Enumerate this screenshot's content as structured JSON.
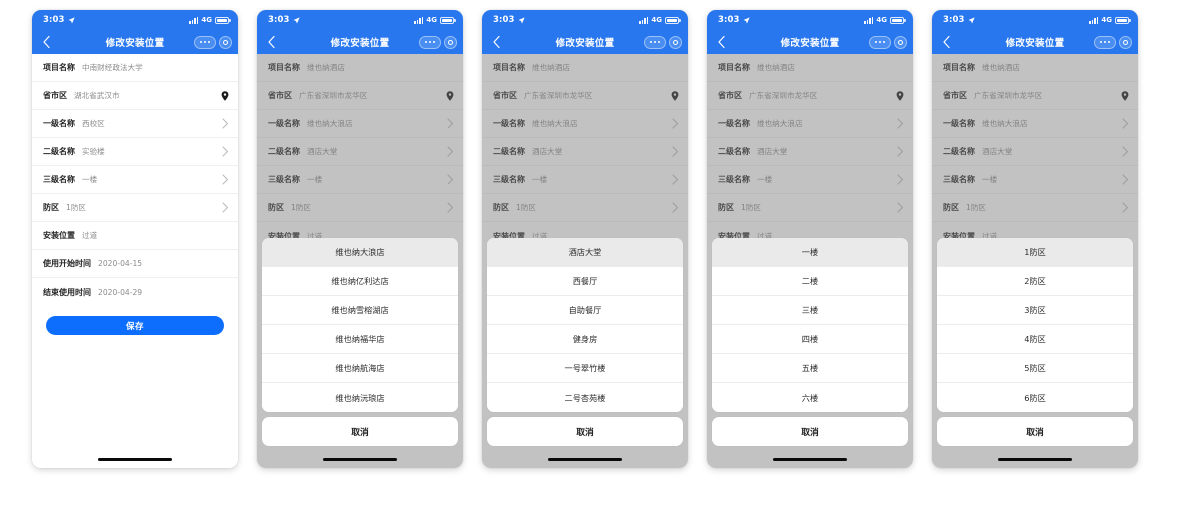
{
  "meta": {
    "accent_blue": "#2877ee",
    "button_blue": "#0d6efd",
    "dim_overlay": "rgba(120,120,120,0.45)",
    "sheet_active_bg": "#eaeaea"
  },
  "statusbar": {
    "time": "3:03",
    "network": "4G",
    "location_icon": "location-arrow-icon",
    "signal_icon": "signal-bars-icon",
    "battery_icon": "battery-icon"
  },
  "navbar": {
    "title": "修改安装位置",
    "back_icon": "chevron-left-icon",
    "menu_icon": "more-dots-icon",
    "close_icon": "target-circle-icon"
  },
  "labels": {
    "project": "项目名称",
    "region": "省市区",
    "level1": "一级名称",
    "level2": "二级名称",
    "level3": "三级名称",
    "zone": "防区",
    "position": "安装位置",
    "start_time": "使用开始时间",
    "end_time": "结束使用时间",
    "save": "保存",
    "cancel": "取消"
  },
  "phones": [
    {
      "id": "phone-detail-form",
      "form": {
        "project": "中南财经政法大学",
        "region": "湖北省武汉市",
        "level1": "西校区",
        "level2": "实验楼",
        "level3": "一楼",
        "zone": "1防区",
        "position": "过道",
        "start_time": "2020-04-15",
        "end_time": "2020-04-29"
      },
      "has_sheet": false,
      "has_save": true
    },
    {
      "id": "phone-level1-picker",
      "form": {
        "project": "维也纳酒店",
        "region": "广东省深圳市龙华区",
        "level1": "维也纳大浪店",
        "level2": "酒店大堂",
        "level3": "一楼",
        "zone": "1防区",
        "position": "过道"
      },
      "has_sheet": true,
      "has_save": false,
      "sheet": {
        "selected_index": 0,
        "options": [
          "维也纳大浪店",
          "维也纳亿利达店",
          "维也纳雪榕湖店",
          "维也纳福华店",
          "维也纳航海店",
          "维也纳沅琅店"
        ]
      }
    },
    {
      "id": "phone-level2-picker",
      "form": {
        "project": "维也纳酒店",
        "region": "广东省深圳市龙华区",
        "level1": "维也纳大浪店",
        "level2": "酒店大堂",
        "level3": "一楼",
        "zone": "1防区",
        "position": "过道"
      },
      "has_sheet": true,
      "has_save": false,
      "sheet": {
        "selected_index": 0,
        "options": [
          "酒店大堂",
          "西餐厅",
          "自助餐厅",
          "健身房",
          "一号翠竹楼",
          "二号杏苑楼"
        ]
      }
    },
    {
      "id": "phone-level3-picker",
      "form": {
        "project": "维也纳酒店",
        "region": "广东省深圳市龙华区",
        "level1": "维也纳大浪店",
        "level2": "酒店大堂",
        "level3": "一楼",
        "zone": "1防区",
        "position": "过道"
      },
      "has_sheet": true,
      "has_save": false,
      "sheet": {
        "selected_index": 0,
        "options": [
          "一楼",
          "二楼",
          "三楼",
          "四楼",
          "五楼",
          "六楼"
        ]
      }
    },
    {
      "id": "phone-zone-picker",
      "form": {
        "project": "维也纳酒店",
        "region": "广东省深圳市龙华区",
        "level1": "维也纳大浪店",
        "level2": "酒店大堂",
        "level3": "一楼",
        "zone": "1防区",
        "position": "过道"
      },
      "has_sheet": true,
      "has_save": false,
      "sheet": {
        "selected_index": 0,
        "options": [
          "1防区",
          "2防区",
          "3防区",
          "4防区",
          "5防区",
          "6防区"
        ]
      }
    }
  ]
}
